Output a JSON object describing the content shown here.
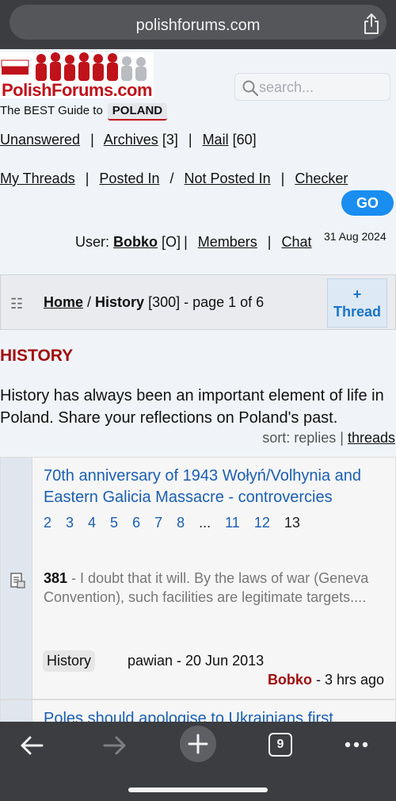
{
  "browser": {
    "url": "polishforums.com",
    "tab_count": "9"
  },
  "site": {
    "logo_text": "PolishForums.com",
    "tagline": "The BEST Guide to",
    "tagline_badge": "POLAND",
    "search_placeholder": "search..."
  },
  "nav": {
    "unanswered": "Unanswered",
    "archives": "Archives",
    "archives_count": "[3]",
    "mail": "Mail",
    "mail_count": "[60]",
    "my_threads": "My Threads",
    "posted_in": "Posted In",
    "not_posted_in": "Not Posted In",
    "checker": "Checker",
    "go": "GO",
    "user_prefix": "User:",
    "username": "Bobko",
    "user_flag": "[O]",
    "members": "Members",
    "chat": "Chat",
    "date": "31 Aug 2024"
  },
  "breadcrumb": {
    "home": "Home",
    "section": "History",
    "info": "[300] - page 1 of 6",
    "thread_plus": "+",
    "thread_label": "Thread"
  },
  "section": {
    "title": "HISTORY",
    "description": "History has always been an important element of life in Poland. Share your reflections on Poland's past.",
    "sort_label": "sort: replies |",
    "sort_threads": "threads"
  },
  "threads": [
    {
      "title": "70th anniversary of 1943 Wołyń/Volhynia and Eastern Galicia Massacre - controvercies",
      "pages": [
        "2",
        "3",
        "4",
        "5",
        "6",
        "7",
        "8",
        "...",
        "11",
        "12",
        "13"
      ],
      "reply_count": "381",
      "snippet": "- I doubt that it will. By the laws of war (Geneva Convention), such facilities are legitimate targets....",
      "category": "History",
      "starter": "pawian - 20 Jun 2013",
      "last_user": "Bobko",
      "last_time": "- 3 hrs ago"
    },
    {
      "title": "Poles should apologise to Ukrainians first"
    }
  ],
  "icons": {
    "share": "share-icon",
    "search": "search-icon",
    "breadcrumb": "forum-icon",
    "thread_doc": "document-icon",
    "back": "back-arrow-icon",
    "forward": "forward-arrow-icon",
    "new_tab": "plus-icon",
    "tabs": "tabs-icon",
    "more": "more-icon"
  },
  "colors": {
    "accent_blue": "#1a8df0",
    "link_blue": "#1b5fb4",
    "title_red": "#a10d0d",
    "brand_red": "#c0121b"
  }
}
